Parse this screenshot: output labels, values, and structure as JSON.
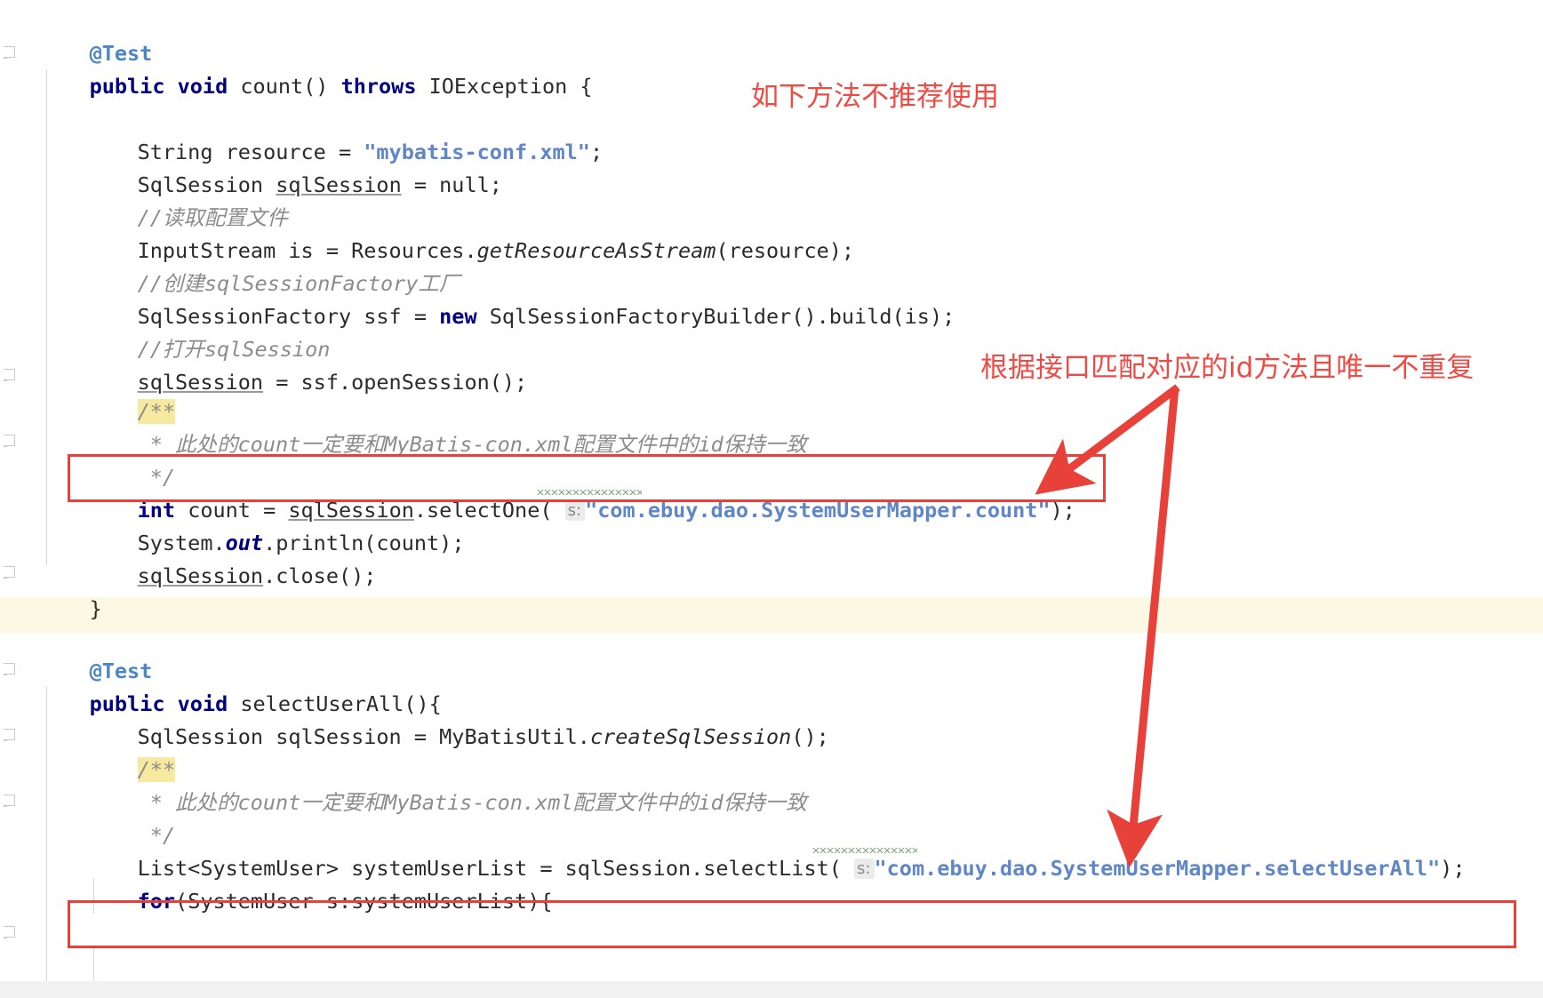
{
  "editor": {
    "background_color": "#ffffff",
    "text_color": "#2b2b2b",
    "keyword_color": "#000080",
    "string_color": "#5f86c6",
    "comment_color": "#8c8c8c",
    "annotation_color": "#4a86c8",
    "highlight_color": "#f7e9a0",
    "band_color": "#fdf8e3",
    "accent_red": "#e8413a"
  },
  "method_one": {
    "annotation": "@Test",
    "signature_kw_public": "public",
    "signature_kw_void": "void",
    "signature_name": "count() ",
    "signature_kw_throws": "throws",
    "signature_tail": " IOException {",
    "line_resource_pre": "String resource = ",
    "line_resource_str": "\"mybatis-conf.xml\"",
    "line_resource_post": ";",
    "line_sqlsession_pre": "SqlSession ",
    "line_sqlsession_var": "sqlSession",
    "line_sqlsession_post": " = null;",
    "comment_read_config": "//读取配置文件",
    "line_inputstream_pre": "InputStream is = Resources.",
    "line_inputstream_italic": "getResourceAsStream",
    "line_inputstream_post": "(resource);",
    "comment_create_factory": "//创建sqlSessionFactory工厂",
    "line_factory_pre": "SqlSessionFactory ssf = ",
    "line_factory_kw": "new",
    "line_factory_post": " SqlSessionFactoryBuilder().build(is);",
    "comment_open_session": "//打开sqlSession",
    "line_open_var": "sqlSession",
    "line_open_post": " = ssf.openSession();",
    "javadoc_open": "/**",
    "javadoc_body": " * 此处的count一定要和MyBatis-con.xml配置文件中的id保持一致",
    "javadoc_close": " */",
    "line_count_kw": "int",
    "line_count_mid": " count = ",
    "line_count_var": "sqlSession",
    "line_count_call": ".selectOne( ",
    "line_count_hint": "s:",
    "line_count_str": "\"com.ebuy.dao.SystemUserMapper.count\"",
    "line_count_tail": ");",
    "line_println_pre": "System.",
    "line_println_out": "out",
    "line_println_post": ".println(count);",
    "line_close_var": "sqlSession",
    "line_close_post": ".close();",
    "closing_brace": "}"
  },
  "method_two": {
    "annotation": "@Test",
    "signature_kw_public": "public",
    "signature_kw_void": "void",
    "signature_name": "selectUserAll(){",
    "line_session_pre": "SqlSession sqlSession = MyBatisUtil.",
    "line_session_italic": "createSqlSession",
    "line_session_post": "();",
    "javadoc_open": "/**",
    "javadoc_body": " * 此处的count一定要和MyBatis-con.xml配置文件中的id保持一致",
    "javadoc_close": " */",
    "line_list_pre": "List<SystemUser> systemUserList = sqlSession.selectList( ",
    "line_list_hint": "s:",
    "line_list_str": "\"com.ebuy.dao.SystemUserMapper.selectUserAll\"",
    "line_list_tail": ");",
    "line_for_kw": "for",
    "line_for_post": "(SystemUser s:systemUserList){"
  },
  "annotations": {
    "note_top": "如下方法不推荐使用",
    "note_right": "根据接口匹配对应的id方法且唯一不重复",
    "arrow_one_label": "arrow-to-count-line",
    "arrow_two_label": "arrow-to-selectuserall-line"
  }
}
